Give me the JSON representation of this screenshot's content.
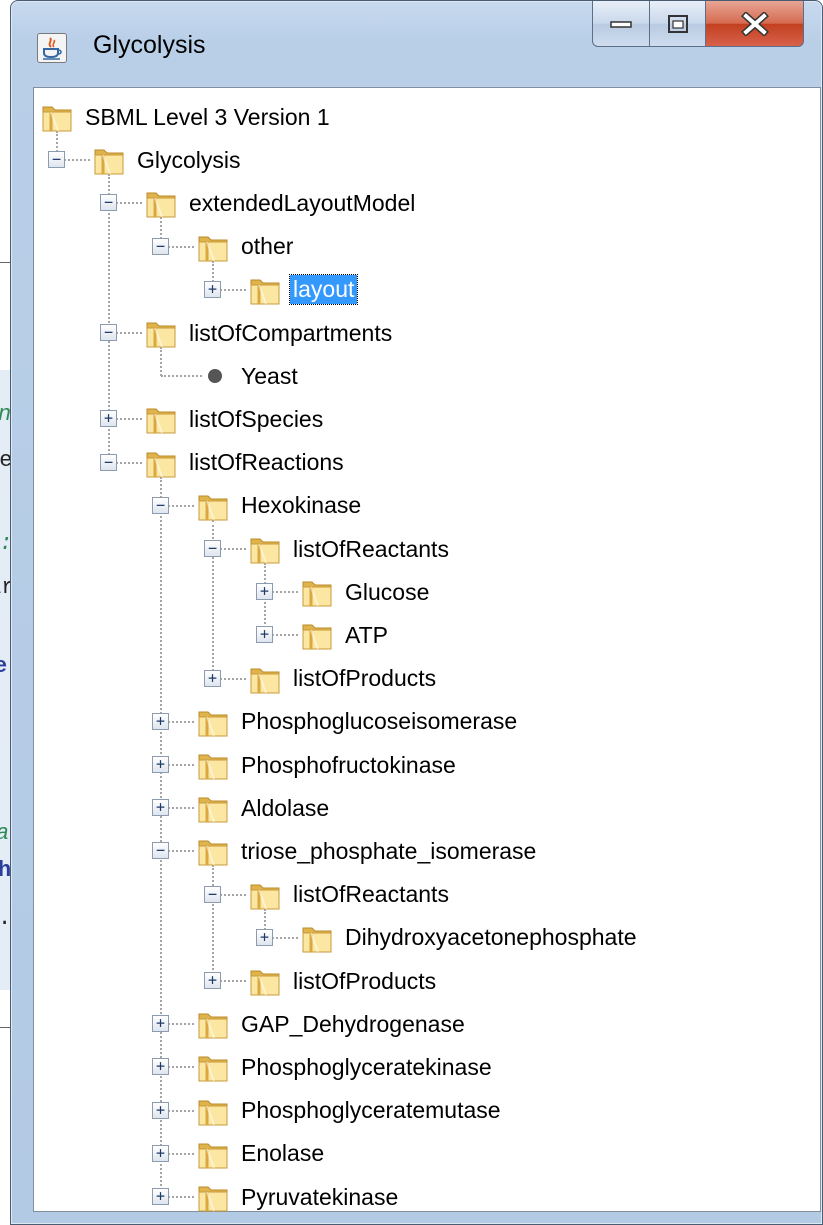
{
  "window": {
    "title": "Glycolysis"
  },
  "window_buttons": {
    "minimize": "minimize",
    "maximize": "maximize",
    "close": "close"
  },
  "background_fragments": [
    "n",
    "he",
    "o:",
    "ar",
    "e",
    "a",
    "h",
    "."
  ],
  "tree": [
    {
      "label": "SBML Level 3 Version 1",
      "depth": 0,
      "toggle": null,
      "icon": "folder-icon"
    },
    {
      "label": "Glycolysis",
      "depth": 1,
      "toggle": "collapse",
      "icon": "folder-icon"
    },
    {
      "label": "extendedLayoutModel",
      "depth": 2,
      "toggle": "collapse",
      "icon": "folder-icon"
    },
    {
      "label": "other",
      "depth": 3,
      "toggle": "collapse",
      "icon": "folder-icon"
    },
    {
      "label": "layout",
      "depth": 4,
      "toggle": "expand",
      "icon": "folder-icon",
      "selected": true
    },
    {
      "label": "listOfCompartments",
      "depth": 2,
      "toggle": "collapse",
      "icon": "folder-icon"
    },
    {
      "label": "Yeast",
      "depth": 3,
      "toggle": null,
      "icon": "leaf-dot-icon"
    },
    {
      "label": "listOfSpecies",
      "depth": 2,
      "toggle": "expand",
      "icon": "folder-icon"
    },
    {
      "label": "listOfReactions",
      "depth": 2,
      "toggle": "collapse",
      "icon": "folder-icon"
    },
    {
      "label": "Hexokinase",
      "depth": 3,
      "toggle": "collapse",
      "icon": "folder-icon"
    },
    {
      "label": "listOfReactants",
      "depth": 4,
      "toggle": "collapse",
      "icon": "folder-icon"
    },
    {
      "label": "Glucose",
      "depth": 5,
      "toggle": "expand",
      "icon": "folder-icon"
    },
    {
      "label": "ATP",
      "depth": 5,
      "toggle": "expand",
      "icon": "folder-icon"
    },
    {
      "label": "listOfProducts",
      "depth": 4,
      "toggle": "expand",
      "icon": "folder-icon"
    },
    {
      "label": "Phosphoglucoseisomerase",
      "depth": 3,
      "toggle": "expand",
      "icon": "folder-icon"
    },
    {
      "label": "Phosphofructokinase",
      "depth": 3,
      "toggle": "expand",
      "icon": "folder-icon"
    },
    {
      "label": "Aldolase",
      "depth": 3,
      "toggle": "expand",
      "icon": "folder-icon"
    },
    {
      "label": "triose_phosphate_isomerase",
      "depth": 3,
      "toggle": "collapse",
      "icon": "folder-icon"
    },
    {
      "label": "listOfReactants",
      "depth": 4,
      "toggle": "collapse",
      "icon": "folder-icon"
    },
    {
      "label": "Dihydroxyacetonephosphate",
      "depth": 5,
      "toggle": "expand",
      "icon": "folder-icon"
    },
    {
      "label": "listOfProducts",
      "depth": 4,
      "toggle": "expand",
      "icon": "folder-icon"
    },
    {
      "label": "GAP_Dehydrogenase",
      "depth": 3,
      "toggle": "expand",
      "icon": "folder-icon"
    },
    {
      "label": "Phosphoglyceratekinase",
      "depth": 3,
      "toggle": "expand",
      "icon": "folder-icon"
    },
    {
      "label": "Phosphoglyceratemutase",
      "depth": 3,
      "toggle": "expand",
      "icon": "folder-icon"
    },
    {
      "label": "Enolase",
      "depth": 3,
      "toggle": "expand",
      "icon": "folder-icon"
    },
    {
      "label": "Pyruvatekinase",
      "depth": 3,
      "toggle": "expand",
      "icon": "folder-icon"
    }
  ],
  "colors": {
    "selection": "#3399ff",
    "folder_light": "#fbe7a1",
    "folder_dark": "#e0b44c",
    "close_button": "#c2401f"
  }
}
